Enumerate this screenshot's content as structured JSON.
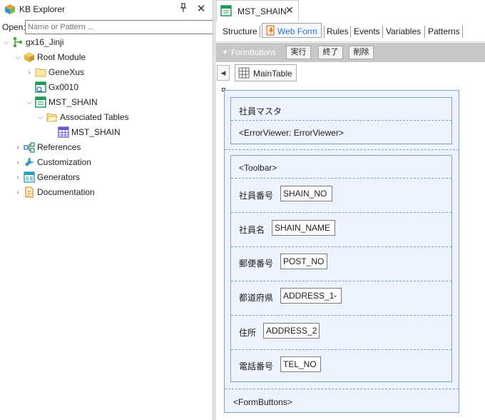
{
  "explorer": {
    "title": "KB Explorer",
    "pin_icon": "pin-icon",
    "close_symbol": "✕",
    "open_label": "Open:",
    "open_placeholder": "Name or Pattern ...",
    "tree": {
      "root": "gx16_Jinji",
      "root_module": "Root Module",
      "genexus": "GeneXus",
      "gx0010": "Gx0010",
      "mst_shain": "MST_SHAIN",
      "associated_tables": "Associated Tables",
      "table_mst_shain": "MST_SHAIN",
      "references": "References",
      "customization": "Customization",
      "generators": "Generators",
      "documentation": "Documentation"
    }
  },
  "editor": {
    "doc_tab": "MST_SHAIN",
    "doc_tab_close": "✕",
    "tabs": [
      "Structure",
      "Web Form",
      "Rules",
      "Events",
      "Variables",
      "Patterns"
    ],
    "active_tab": "Web Form",
    "form_buttons_bar": {
      "title": "FormButtons",
      "buttons": [
        "実行",
        "終了",
        "削除"
      ]
    },
    "main_table_label": "MainTable",
    "form": {
      "title": "社員マスタ",
      "error_viewer": "<ErrorViewer: ErrorViewer>",
      "toolbar": "<Toolbar>",
      "fields": [
        {
          "label": "社員番号",
          "value": "SHAIN_NO"
        },
        {
          "label": "社員名",
          "value": "SHAIN_NAME"
        },
        {
          "label": "郵便番号",
          "value": "POST_NO"
        },
        {
          "label": "都道府県",
          "value": "ADDRESS_1"
        },
        {
          "label": "住所",
          "value": "ADDRESS_2"
        },
        {
          "label": "電話番号",
          "value": "TEL_NO"
        }
      ],
      "form_buttons": "<FormButtons>"
    }
  },
  "colors": {
    "accent_blue": "#2f74d0",
    "form_box_border": "#7ea0d9",
    "form_box_fill": "#edf3fc",
    "toolbar_gray": "#c8c8c8"
  }
}
